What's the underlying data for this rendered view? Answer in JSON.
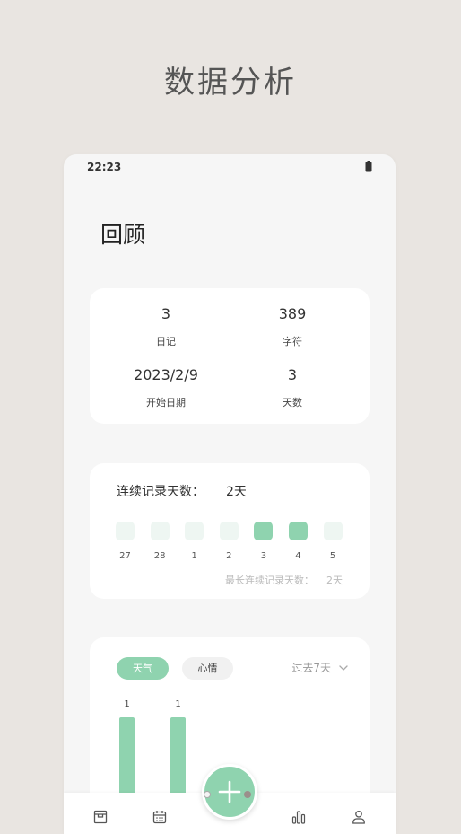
{
  "promo": {
    "title": "数据分析"
  },
  "status_bar": {
    "time": "22:23",
    "battery_icon": "battery-icon"
  },
  "page": {
    "title": "回顾"
  },
  "summary": {
    "diary_count": "3",
    "diary_label": "日记",
    "char_count": "389",
    "char_label": "字符",
    "start_date": "2023/2/9",
    "start_date_label": "开始日期",
    "day_count": "3",
    "day_count_label": "天数"
  },
  "streak": {
    "title": "连续记录天数：",
    "value": "2天",
    "days": [
      {
        "label": "27",
        "active": false
      },
      {
        "label": "28",
        "active": false
      },
      {
        "label": "1",
        "active": false
      },
      {
        "label": "2",
        "active": false
      },
      {
        "label": "3",
        "active": true
      },
      {
        "label": "4",
        "active": true
      },
      {
        "label": "5",
        "active": false
      }
    ],
    "longest_label": "最长连续记录天数：",
    "longest_value": "2天"
  },
  "analysis": {
    "tabs": [
      {
        "label": "天气",
        "active": true
      },
      {
        "label": "心情",
        "active": false
      }
    ],
    "range": "过去7天",
    "range_icon": "chevron-down-icon",
    "bars": [
      {
        "label": "1",
        "value": 1
      },
      {
        "label": "1",
        "value": 1
      }
    ]
  },
  "nav": {
    "items": [
      {
        "icon": "archive-icon"
      },
      {
        "icon": "calendar-icon"
      },
      {
        "icon": "bar-chart-icon"
      },
      {
        "icon": "profile-icon"
      }
    ],
    "fab_icon": "plus-icon"
  },
  "colors": {
    "accent": "#8fd3af",
    "accent_light": "#eef6f2",
    "page_background": "#e9e5e1",
    "card": "#ffffff"
  }
}
